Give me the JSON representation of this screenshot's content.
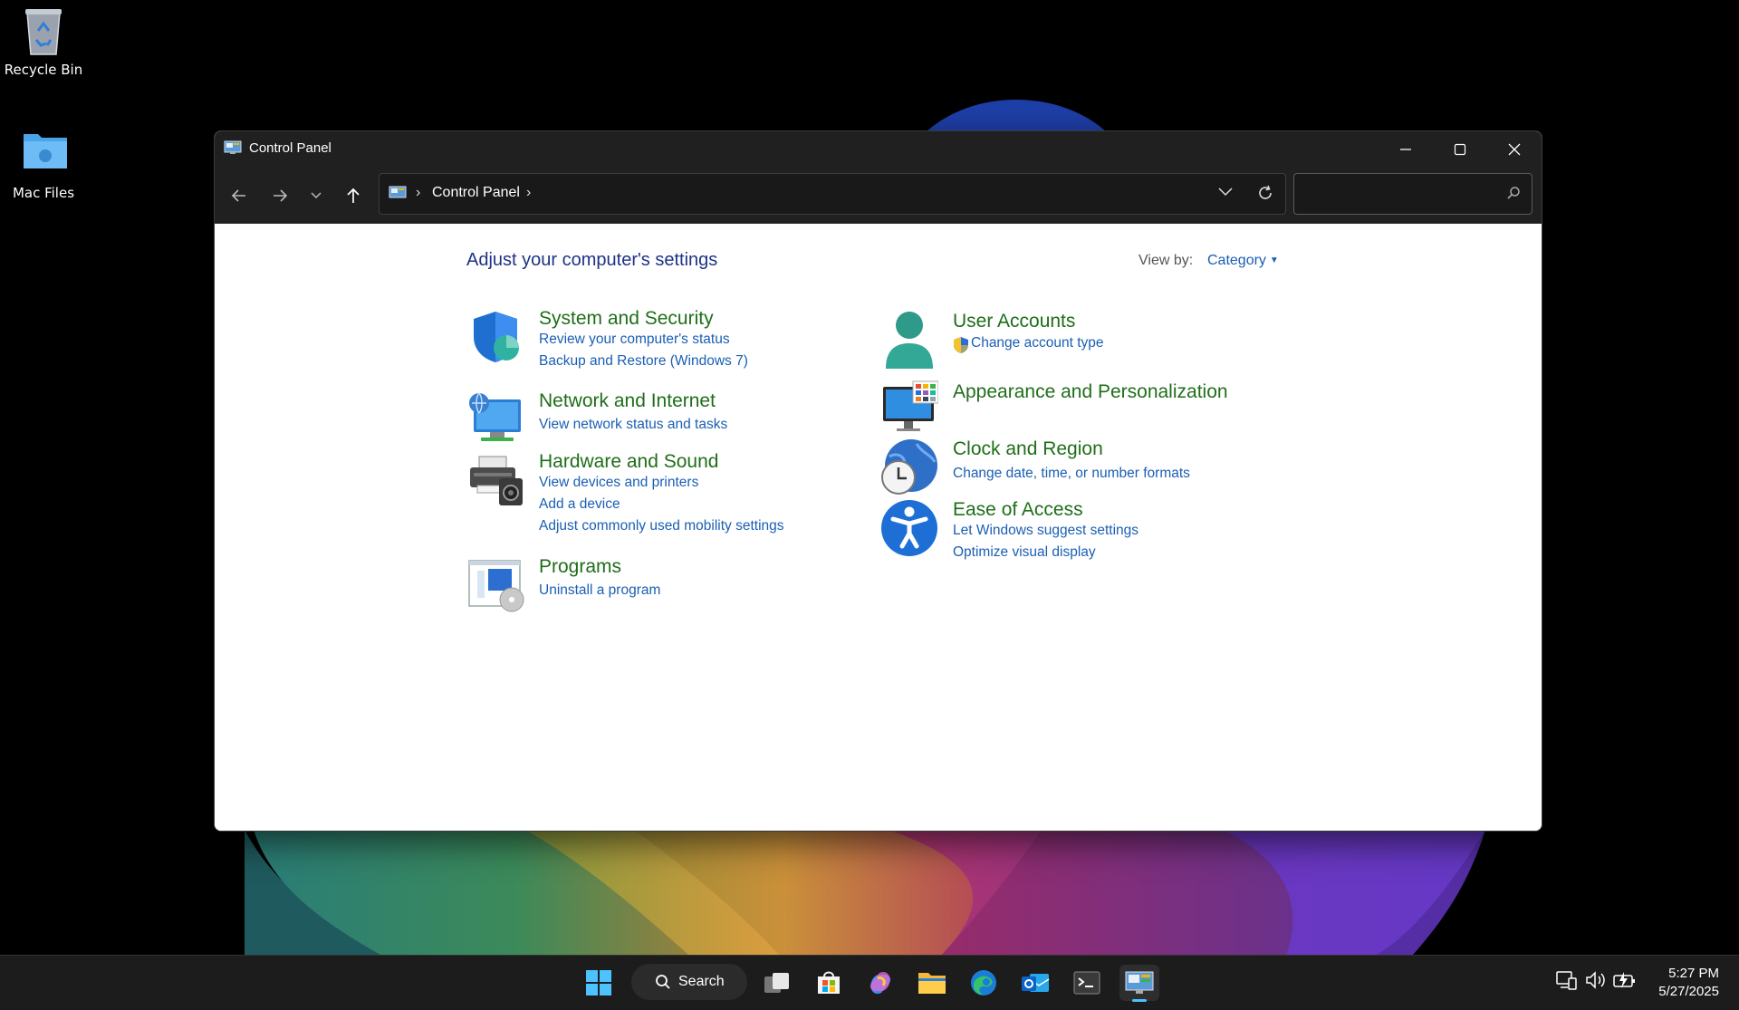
{
  "desktop": {
    "icons": [
      {
        "label": "Recycle Bin"
      },
      {
        "label": "Mac Files"
      }
    ]
  },
  "window": {
    "title": "Control Panel",
    "address": {
      "crumb": "Control Panel",
      "separator": "›"
    },
    "search": {
      "placeholder": ""
    }
  },
  "content": {
    "heading": "Adjust your computer's settings",
    "view_by_label": "View by:",
    "view_by_value": "Category",
    "categories_left": [
      {
        "title": "System and Security",
        "links": [
          "Review your computer's status",
          "Backup and Restore (Windows 7)"
        ]
      },
      {
        "title": "Network and Internet",
        "links": [
          "View network status and tasks"
        ]
      },
      {
        "title": "Hardware and Sound",
        "links": [
          "View devices and printers",
          "Add a device",
          "Adjust commonly used mobility settings"
        ]
      },
      {
        "title": "Programs",
        "links": [
          "Uninstall a program"
        ]
      }
    ],
    "categories_right": [
      {
        "title": "User Accounts",
        "links": [
          "Change account type"
        ]
      },
      {
        "title": "Appearance and Personalization",
        "links": []
      },
      {
        "title": "Clock and Region",
        "links": [
          "Change date, time, or number formats"
        ]
      },
      {
        "title": "Ease of Access",
        "links": [
          "Let Windows suggest settings",
          "Optimize visual display"
        ]
      }
    ]
  },
  "taskbar": {
    "search_label": "Search",
    "time": "5:27 PM",
    "date": "5/27/2025"
  },
  "colors": {
    "heading": "#1e3287",
    "category_title": "#1f6e19",
    "link": "#1a5fb4",
    "accent": "#4cc2ff"
  }
}
